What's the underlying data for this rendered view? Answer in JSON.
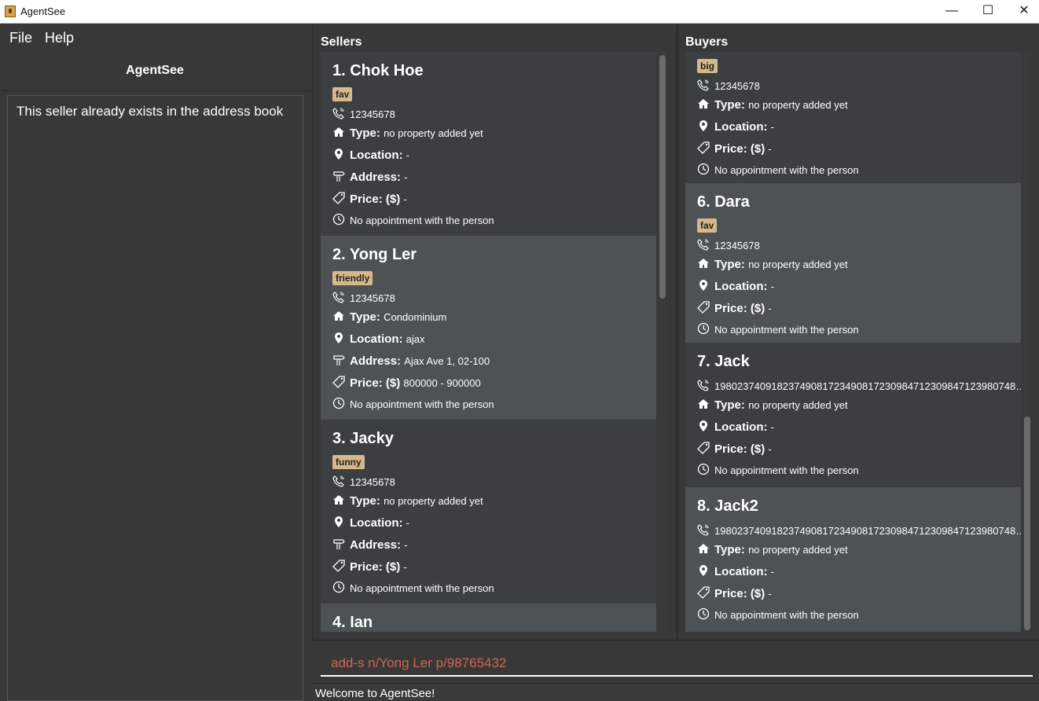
{
  "window": {
    "title": "AgentSee",
    "minimize_icon": "minimize-icon",
    "maximize_icon": "maximize-icon",
    "close_icon": "close-icon"
  },
  "menu": {
    "file": "File",
    "help": "Help"
  },
  "left": {
    "heading": "AgentSee",
    "result": "This seller already exists in the address book"
  },
  "sellers": {
    "title": "Sellers",
    "cards": [
      {
        "title": "1.  Chok Hoe",
        "tag": "fav",
        "phone": "12345678",
        "type_label": "Type:",
        "type": "no property added yet",
        "location_label": "Location:",
        "location": "-",
        "address_label": "Address:",
        "address": "-",
        "price_label": "Price: ($)",
        "price": "-",
        "appointment": "No appointment with the person"
      },
      {
        "title": "2.  Yong Ler",
        "tag": "friendly",
        "phone": "12345678",
        "type_label": "Type:",
        "type": "Condominium",
        "location_label": "Location:",
        "location": "ajax",
        "address_label": "Address:",
        "address": "Ajax Ave 1, 02-100",
        "price_label": "Price: ($)",
        "price": "800000  -  900000",
        "appointment": "No appointment with the person"
      },
      {
        "title": "3.  Jacky",
        "tag": "funny",
        "phone": "12345678",
        "type_label": "Type:",
        "type": "no property added yet",
        "location_label": "Location:",
        "location": "-",
        "address_label": "Address:",
        "address": "-",
        "price_label": "Price: ($)",
        "price": "-",
        "appointment": "No appointment with the person"
      },
      {
        "title": "4.  Ian"
      }
    ]
  },
  "buyers": {
    "title": "Buyers",
    "cards": [
      {
        "title": "",
        "tag": "big",
        "phone": "12345678",
        "type_label": "Type:",
        "type": "no property added yet",
        "location_label": "Location:",
        "location": "-",
        "price_label": "Price: ($)",
        "price": "-",
        "appointment": "No appointment with the person"
      },
      {
        "title": "6.  Dara",
        "tag": "fav",
        "phone": "12345678",
        "type_label": "Type:",
        "type": "no property added yet",
        "location_label": "Location:",
        "location": "-",
        "price_label": "Price: ($)",
        "price": "-",
        "appointment": "No appointment with the person"
      },
      {
        "title": "7.  Jack",
        "phone": "19802374091823749081723490817230984712309847123980748…",
        "type_label": "Type:",
        "type": "no property added yet",
        "location_label": "Location:",
        "location": "-",
        "price_label": "Price: ($)",
        "price": "-",
        "appointment": "No appointment with the person"
      },
      {
        "title": "8.  Jack2",
        "phone": "19802374091823749081723490817230984712309847123980748…",
        "type_label": "Type:",
        "type": "no property added yet",
        "location_label": "Location:",
        "location": "-",
        "price_label": "Price: ($)",
        "price": "-",
        "appointment": "No appointment with the person"
      }
    ]
  },
  "command": {
    "value": "add-s n/Yong Ler p/98765432"
  },
  "status": {
    "text": "Welcome to AgentSee!"
  },
  "colors": {
    "card_dark": "#3c3f41",
    "card_light": "#4d5254",
    "tag": "#d6b98a",
    "command_text": "#d06651"
  },
  "icons": {
    "phone": "phone-icon",
    "home": "home-icon",
    "location": "location-pin-icon",
    "address": "signpost-icon",
    "price": "price-tag-icon",
    "clock": "clock-icon"
  }
}
